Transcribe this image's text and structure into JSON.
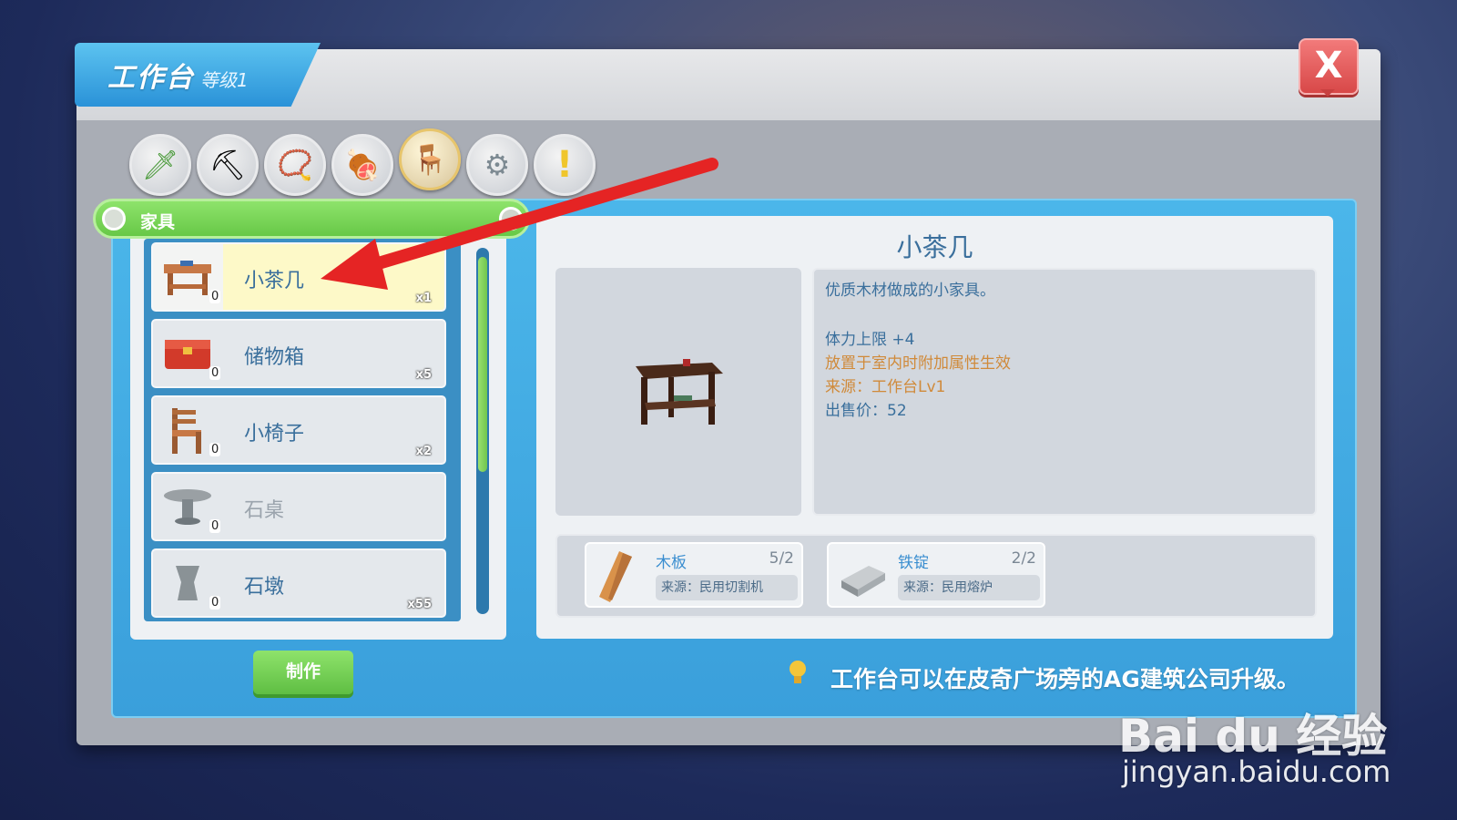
{
  "window": {
    "title": "工作台",
    "level": "等级1",
    "close_label": "X"
  },
  "categories": [
    {
      "icon": "sword-icon",
      "glyph": "🗡"
    },
    {
      "icon": "pickaxe-icon",
      "glyph": "⛏"
    },
    {
      "icon": "necklace-icon",
      "glyph": "📿"
    },
    {
      "icon": "meat-icon",
      "glyph": "🍖"
    },
    {
      "icon": "chair-icon",
      "glyph": "🪑",
      "active": true
    },
    {
      "icon": "gear-icon",
      "glyph": "⚙"
    },
    {
      "icon": "exclamation-icon",
      "glyph": "❗"
    }
  ],
  "list": {
    "category_label": "家具",
    "items": [
      {
        "name": "小茶几",
        "count": "0",
        "qty": "x1",
        "icon": "tea-table-icon",
        "glyph": "🛋",
        "selected": true
      },
      {
        "name": "储物箱",
        "count": "0",
        "qty": "x5",
        "icon": "storage-box-icon",
        "glyph": "🧰"
      },
      {
        "name": "小椅子",
        "count": "0",
        "qty": "x2",
        "icon": "small-chair-icon",
        "glyph": "🪑"
      },
      {
        "name": "石桌",
        "count": "0",
        "qty": "",
        "icon": "stone-table-icon",
        "glyph": "🪨",
        "disabled": true
      },
      {
        "name": "石墩",
        "count": "0",
        "qty": "x55",
        "icon": "stone-stool-icon",
        "glyph": "🏺"
      }
    ]
  },
  "make_button": "制作",
  "detail": {
    "title": "小茶几",
    "description": "优质木材做成的小家具。",
    "stat": "体力上限 +4",
    "note": "放置于室内时附加属性生效",
    "source": "来源：工作台Lv1",
    "price": "出售价：52"
  },
  "materials": [
    {
      "name": "木板",
      "count": "5/2",
      "source": "来源：民用切割机",
      "icon": "wood-plank-icon"
    },
    {
      "name": "铁锭",
      "count": "2/2",
      "source": "来源：民用熔炉",
      "icon": "iron-ingot-icon"
    }
  ],
  "hint": "工作台可以在皮奇广场旁的AG建筑公司升级。",
  "watermark": {
    "brand": "Bai du 经验",
    "url": "jingyan.baidu.com"
  },
  "colors": {
    "accent_blue": "#3a9fdb",
    "green": "#67c847",
    "close_red": "#d84848",
    "note_orange": "#d08a3a",
    "arrow_red": "#e52424"
  }
}
